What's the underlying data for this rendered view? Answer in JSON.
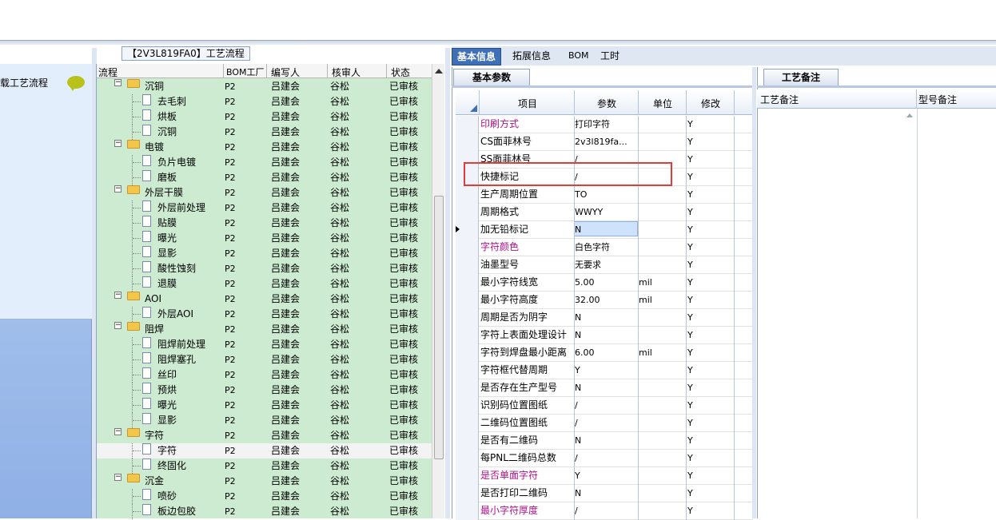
{
  "left": {
    "item_label": "载工艺流程"
  },
  "flow": {
    "title": "【2V3L819FA0】工艺流程",
    "headers": [
      "流程",
      "BOM工厂",
      "编写人",
      "核审人",
      "状态"
    ],
    "rows": [
      {
        "name": "沉铜",
        "level": 0,
        "plant": "P2",
        "writer": "吕建会",
        "reviewer": "谷松",
        "status": "已审核"
      },
      {
        "name": "去毛刺",
        "level": 1,
        "plant": "P2",
        "writer": "吕建会",
        "reviewer": "谷松",
        "status": "已审核"
      },
      {
        "name": "烘板",
        "level": 1,
        "plant": "P2",
        "writer": "吕建会",
        "reviewer": "谷松",
        "status": "已审核"
      },
      {
        "name": "沉铜",
        "level": 1,
        "plant": "P2",
        "writer": "吕建会",
        "reviewer": "谷松",
        "status": "已审核"
      },
      {
        "name": "电镀",
        "level": 0,
        "plant": "P2",
        "writer": "吕建会",
        "reviewer": "谷松",
        "status": "已审核"
      },
      {
        "name": "负片电镀",
        "level": 1,
        "plant": "P2",
        "writer": "吕建会",
        "reviewer": "谷松",
        "status": "已审核"
      },
      {
        "name": "磨板",
        "level": 1,
        "plant": "P2",
        "writer": "吕建会",
        "reviewer": "谷松",
        "status": "已审核"
      },
      {
        "name": "外层干膜",
        "level": 0,
        "plant": "P2",
        "writer": "吕建会",
        "reviewer": "谷松",
        "status": "已审核"
      },
      {
        "name": "外层前处理",
        "level": 1,
        "plant": "P2",
        "writer": "吕建会",
        "reviewer": "谷松",
        "status": "已审核"
      },
      {
        "name": "贴膜",
        "level": 1,
        "plant": "P2",
        "writer": "吕建会",
        "reviewer": "谷松",
        "status": "已审核"
      },
      {
        "name": "曝光",
        "level": 1,
        "plant": "P2",
        "writer": "吕建会",
        "reviewer": "谷松",
        "status": "已审核"
      },
      {
        "name": "显影",
        "level": 1,
        "plant": "P2",
        "writer": "吕建会",
        "reviewer": "谷松",
        "status": "已审核"
      },
      {
        "name": "酸性蚀刻",
        "level": 1,
        "plant": "P2",
        "writer": "吕建会",
        "reviewer": "谷松",
        "status": "已审核"
      },
      {
        "name": "退膜",
        "level": 1,
        "plant": "P2",
        "writer": "吕建会",
        "reviewer": "谷松",
        "status": "已审核"
      },
      {
        "name": "AOI",
        "level": 0,
        "plant": "P2",
        "writer": "吕建会",
        "reviewer": "谷松",
        "status": "已审核"
      },
      {
        "name": "外层AOI",
        "level": 1,
        "plant": "P2",
        "writer": "吕建会",
        "reviewer": "谷松",
        "status": "已审核"
      },
      {
        "name": "阻焊",
        "level": 0,
        "plant": "P2",
        "writer": "吕建会",
        "reviewer": "谷松",
        "status": "已审核"
      },
      {
        "name": "阻焊前处理",
        "level": 1,
        "plant": "P2",
        "writer": "吕建会",
        "reviewer": "谷松",
        "status": "已审核"
      },
      {
        "name": "阻焊塞孔",
        "level": 1,
        "plant": "P2",
        "writer": "吕建会",
        "reviewer": "谷松",
        "status": "已审核"
      },
      {
        "name": "丝印",
        "level": 1,
        "plant": "P2",
        "writer": "吕建会",
        "reviewer": "谷松",
        "status": "已审核"
      },
      {
        "name": "预烘",
        "level": 1,
        "plant": "P2",
        "writer": "吕建会",
        "reviewer": "谷松",
        "status": "已审核"
      },
      {
        "name": "曝光",
        "level": 1,
        "plant": "P2",
        "writer": "吕建会",
        "reviewer": "谷松",
        "status": "已审核"
      },
      {
        "name": "显影",
        "level": 1,
        "plant": "P2",
        "writer": "吕建会",
        "reviewer": "谷松",
        "status": "已审核"
      },
      {
        "name": "字符",
        "level": 0,
        "plant": "P2",
        "writer": "吕建会",
        "reviewer": "谷松",
        "status": "已审核"
      },
      {
        "name": "字符",
        "level": 1,
        "plant": "P2",
        "writer": "吕建会",
        "reviewer": "谷松",
        "status": "已审核",
        "selected": true
      },
      {
        "name": "终固化",
        "level": 1,
        "plant": "P2",
        "writer": "吕建会",
        "reviewer": "谷松",
        "status": "已审核"
      },
      {
        "name": "沉金",
        "level": 0,
        "plant": "P2",
        "writer": "吕建会",
        "reviewer": "谷松",
        "status": "已审核"
      },
      {
        "name": "喷砂",
        "level": 1,
        "plant": "P2",
        "writer": "吕建会",
        "reviewer": "谷松",
        "status": "已审核"
      },
      {
        "name": "板边包胶",
        "level": 1,
        "plant": "P2",
        "writer": "吕建会",
        "reviewer": "谷松",
        "status": "已审核"
      }
    ]
  },
  "tabs": [
    "基本信息",
    "拓展信息",
    "BOM",
    "工时"
  ],
  "basic": {
    "subtab": "基本参数",
    "headers": [
      "项目",
      "参数",
      "单位",
      "修改"
    ],
    "rows": [
      {
        "item": "印刷方式",
        "param": "打印字符",
        "unit": "",
        "mod": "Y",
        "pink": true
      },
      {
        "item": "CS面菲林号",
        "param": "2v3l819fa...",
        "unit": "",
        "mod": "Y"
      },
      {
        "item": "SS面菲林号",
        "param": "/",
        "unit": "",
        "mod": "Y"
      },
      {
        "item": "快捷标记",
        "param": "/",
        "unit": "",
        "mod": "Y"
      },
      {
        "item": "生产周期位置",
        "param": "TO",
        "unit": "",
        "mod": "Y"
      },
      {
        "item": "周期格式",
        "param": "WWYY",
        "unit": "",
        "mod": "Y"
      },
      {
        "item": "加无铅标记",
        "param": "N",
        "unit": "",
        "mod": "Y",
        "current": true
      },
      {
        "item": "字符颜色",
        "param": "白色字符",
        "unit": "",
        "mod": "Y",
        "pink": true
      },
      {
        "item": "油墨型号",
        "param": "无要求",
        "unit": "",
        "mod": "Y"
      },
      {
        "item": "最小字符线宽",
        "param": "5.00",
        "unit": "mil",
        "mod": "Y"
      },
      {
        "item": "最小字符高度",
        "param": "32.00",
        "unit": "mil",
        "mod": "Y"
      },
      {
        "item": "周期是否为阴字",
        "param": "N",
        "unit": "",
        "mod": "Y"
      },
      {
        "item": "字符上表面处理设计",
        "param": "N",
        "unit": "",
        "mod": "Y"
      },
      {
        "item": "字符到焊盘最小距离",
        "param": "6.00",
        "unit": "mil",
        "mod": "Y"
      },
      {
        "item": "字符框代替周期",
        "param": "Y",
        "unit": "",
        "mod": "Y"
      },
      {
        "item": "是否存在生产型号",
        "param": "N",
        "unit": "",
        "mod": "Y"
      },
      {
        "item": "识别码位置图纸",
        "param": "/",
        "unit": "",
        "mod": "Y"
      },
      {
        "item": "二维码位置图纸",
        "param": "/",
        "unit": "",
        "mod": "Y"
      },
      {
        "item": "是否有二维码",
        "param": "N",
        "unit": "",
        "mod": "Y"
      },
      {
        "item": "每PNL二维码总数",
        "param": "/",
        "unit": "",
        "mod": "Y"
      },
      {
        "item": "是否单面字符",
        "param": "Y",
        "unit": "",
        "mod": "Y",
        "pink": true
      },
      {
        "item": "是否打印二维码",
        "param": "N",
        "unit": "",
        "mod": "Y"
      },
      {
        "item": "最小字符厚度",
        "param": "/",
        "unit": "",
        "mod": "Y",
        "pink": true
      }
    ]
  },
  "remarks": {
    "tab": "工艺备注",
    "col1": "工艺备注",
    "col2": "型号备注"
  }
}
